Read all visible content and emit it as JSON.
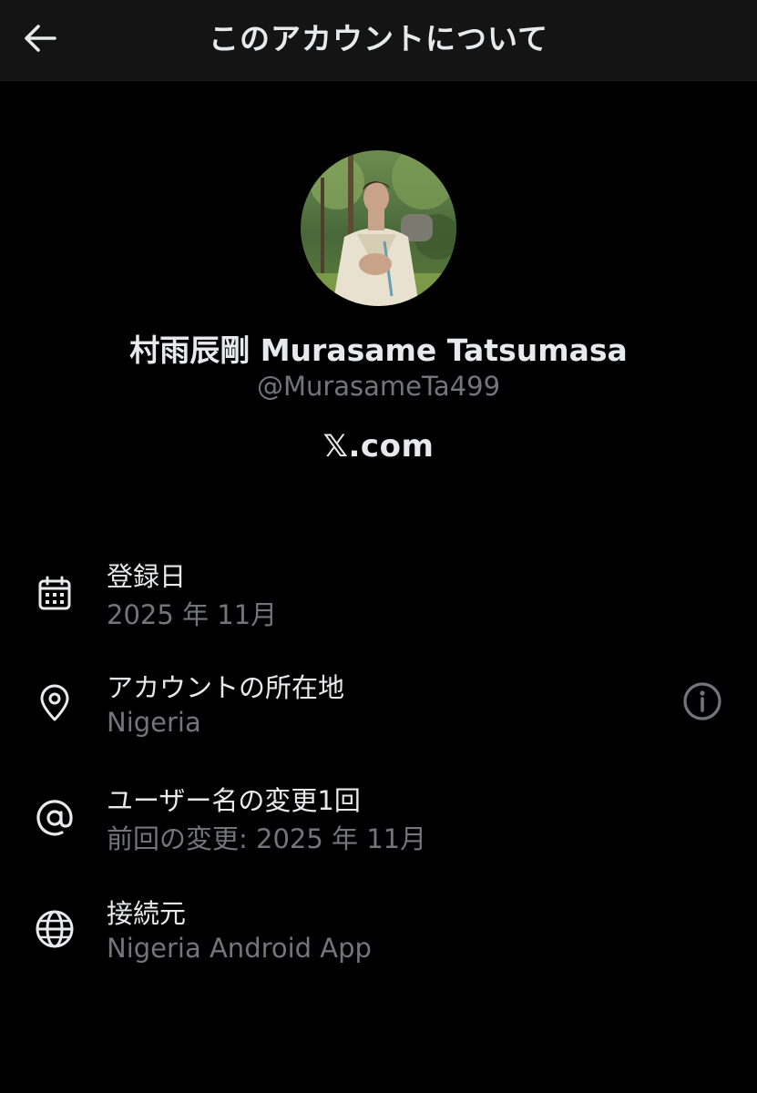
{
  "header": {
    "title": "このアカウントについて",
    "back_icon": "arrow-left-icon"
  },
  "profile": {
    "display_name": "村雨辰剛 Murasame Tatsumasa",
    "handle": "@MurasameTa499",
    "platform": "𝕏.com"
  },
  "details": [
    {
      "icon": "calendar-icon",
      "label": "登録日",
      "value": "2025 年 11月"
    },
    {
      "icon": "location-pin-icon",
      "label": "アカウントの所在地",
      "value": "Nigeria",
      "action_icon": "info-icon"
    },
    {
      "icon": "at-sign-icon",
      "label": "ユーザー名の変更1回",
      "value": "前回の変更: 2025 年 11月"
    },
    {
      "icon": "globe-icon",
      "label": "接続元",
      "value": "Nigeria Android App"
    }
  ],
  "colors": {
    "background": "#000000",
    "header_background": "#141414",
    "primary_text": "#e7e9ea",
    "secondary_text": "#71767b"
  }
}
